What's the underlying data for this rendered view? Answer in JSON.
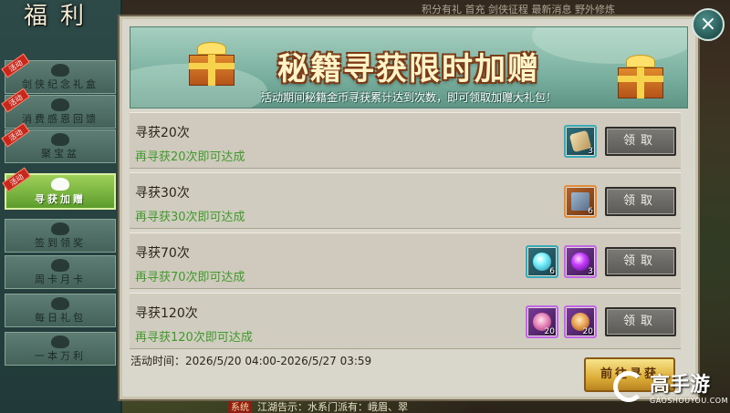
{
  "world": {
    "top_text": "积分有礼  首充  剑侠征程  最新消息  野外修炼",
    "bottom_tag": "系统",
    "bottom_text": "江湖告示：水系门派有：峨眉、翠"
  },
  "sidebar": {
    "title": "福利",
    "hot_label": "活动",
    "items": [
      {
        "label": "剑侠纪念礼盒",
        "icon": "gift-bag-icon",
        "hot": true
      },
      {
        "label": "消费感恩回馈",
        "icon": "coin-icon",
        "hot": true
      },
      {
        "label": "聚宝盆",
        "icon": "treasure-bowl-icon",
        "hot": true
      },
      {
        "label": "寻获加赠",
        "icon": "gift-box-icon",
        "hot": true,
        "active": true
      },
      {
        "label": "签到领奖",
        "icon": "checkin-icon",
        "hot": false
      },
      {
        "label": "周卡月卡",
        "icon": "card-icon",
        "hot": false
      },
      {
        "label": "每日礼包",
        "icon": "daily-pack-icon",
        "hot": false
      },
      {
        "label": "一本万利",
        "icon": "ledger-icon",
        "hot": false
      }
    ]
  },
  "banner": {
    "title": "秘籍寻获限时加赠",
    "subtitle": "活动期间秘籍金币寻获累计达到次数，即可领取加赠大礼包！"
  },
  "rewards": [
    {
      "title": "寻获20次",
      "progress": "再寻获20次即可达成",
      "claim_label": "领取",
      "items": [
        {
          "icon": "scroll-icon",
          "rarity": "blue",
          "count": "3"
        }
      ]
    },
    {
      "title": "寻获30次",
      "progress": "再寻获30次即可达成",
      "claim_label": "领取",
      "items": [
        {
          "icon": "map-scroll-icon",
          "rarity": "orange",
          "count": "6"
        }
      ]
    },
    {
      "title": "寻获70次",
      "progress": "再寻获70次即可达成",
      "claim_label": "领取",
      "items": [
        {
          "icon": "cyan-orb-icon",
          "rarity": "blue",
          "count": "6"
        },
        {
          "icon": "purple-orb-icon",
          "rarity": "purple",
          "count": "3"
        }
      ]
    },
    {
      "title": "寻获120次",
      "progress": "再寻获120次即可达成",
      "claim_label": "领取",
      "items": [
        {
          "icon": "pink-mirror-icon",
          "rarity": "purple",
          "count": "20"
        },
        {
          "icon": "gold-mirror-icon",
          "rarity": "purple",
          "count": "20"
        }
      ]
    }
  ],
  "activity_time": "活动时间：2026/5/20 04:00-2026/5/27 03:59",
  "goto_button": "前往寻获",
  "close_label": "×",
  "watermark": {
    "name": "高手游",
    "url": "GAOSHOUYOU.COM"
  },
  "colors": {
    "progress_text": "#3f9a2b",
    "active_tab": "#7cb840",
    "hot_ribbon": "#c8271c",
    "goto_button": "#dcae38"
  }
}
